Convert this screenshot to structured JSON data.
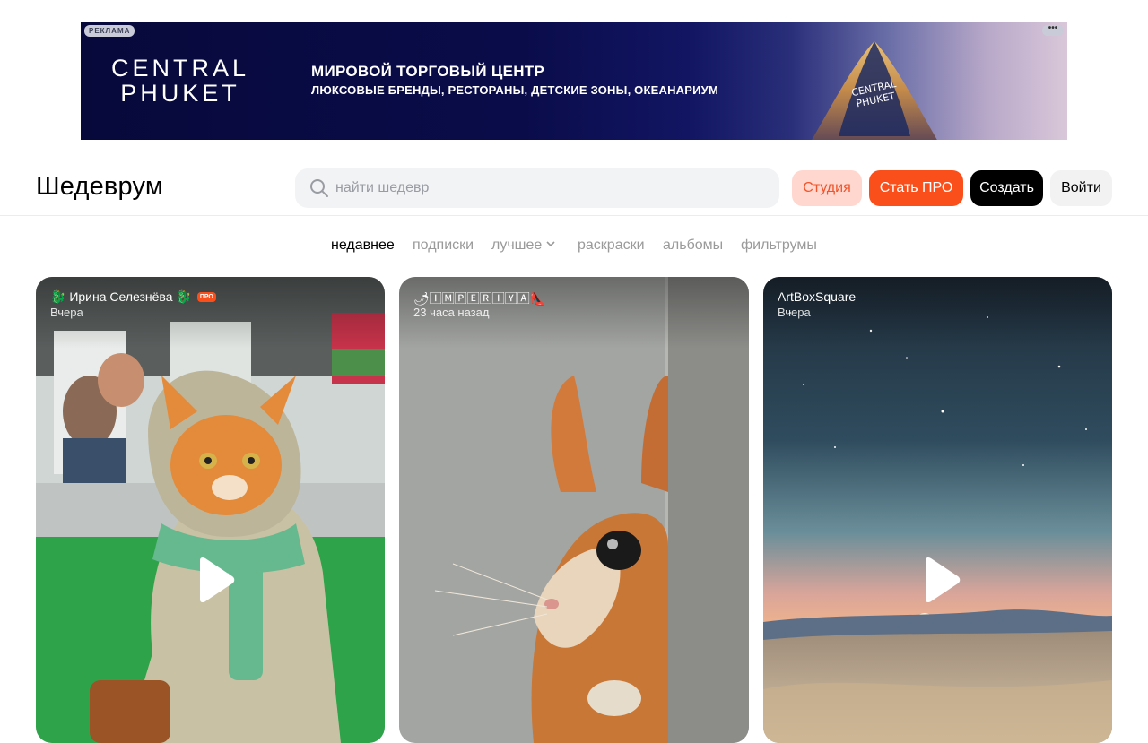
{
  "ad": {
    "badge": "РЕКЛАМА",
    "logo_line1": "CENTRAL",
    "logo_line2": "PHUKET",
    "headline": "МИРОВОЙ ТОРГОВЫЙ ЦЕНТР",
    "subline": "ЛЮКСОВЫЕ БРЕНДЫ, РЕСТОРАНЫ, ДЕТСКИЕ ЗОНЫ, ОКЕАНАРИУМ",
    "menu_label": "•••",
    "tower_line1": "CENTRAL",
    "tower_line2": "PHUKET"
  },
  "header": {
    "logo": "Шедеврум",
    "search_placeholder": "найти шедевр",
    "buttons": {
      "studio": "Студия",
      "pro": "Стать ПРО",
      "create": "Создать",
      "login": "Войти"
    }
  },
  "tabs": [
    {
      "label": "недавнее",
      "active": true
    },
    {
      "label": "подписки",
      "active": false
    },
    {
      "label": "лучшее",
      "active": false
    },
    {
      "label": "раскраски",
      "active": false
    },
    {
      "label": "альбомы",
      "active": false
    },
    {
      "label": "фильтрумы",
      "active": false
    }
  ],
  "cards": [
    {
      "author": "🐉 Ирина Селезнёва 🐉",
      "pro_badge": "ПРО",
      "time": "Вчера",
      "has_video": true
    },
    {
      "author": "🌶🄸🄼🄿🄴🅁🄸🅈🄰👠",
      "time": "23 часа назад",
      "has_video": false
    },
    {
      "author": "ArtBoxSquare",
      "time": "Вчера",
      "has_video": true
    }
  ],
  "colors": {
    "accent": "#fb4f1b",
    "studio_bg": "#ffd7cf",
    "search_bg": "#f2f3f5"
  }
}
